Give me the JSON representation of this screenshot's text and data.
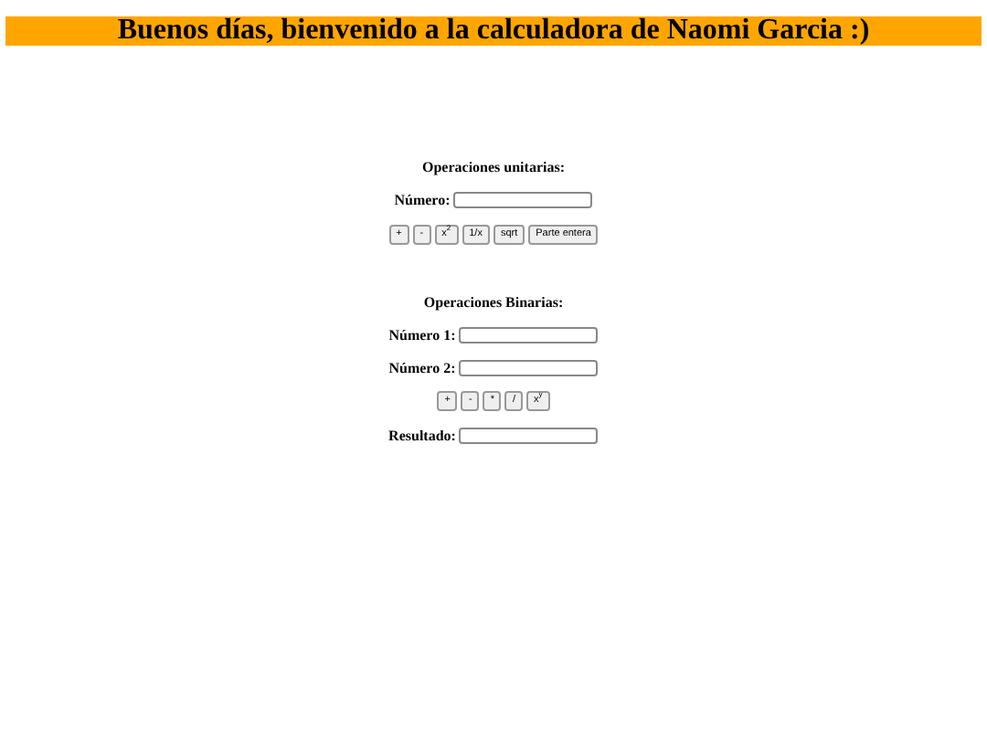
{
  "header": {
    "title": "Buenos días, bienvenido a la calculadora de Naomi Garcia :)"
  },
  "unary": {
    "title": "Operaciones unitarias:",
    "field_label": "Número:",
    "buttons": [
      "+",
      "-",
      "x$^{2}$",
      "1/x",
      "sqrt",
      "Parte entera"
    ]
  },
  "binary": {
    "title": "Operaciones Binarias:",
    "fields": [
      {
        "label": "Número 1:"
      },
      {
        "label": "Número 2:"
      }
    ],
    "buttons": [
      "+",
      "-",
      "*",
      "/",
      "x$^{y}$"
    ],
    "result_label": "Resultado:"
  }
}
